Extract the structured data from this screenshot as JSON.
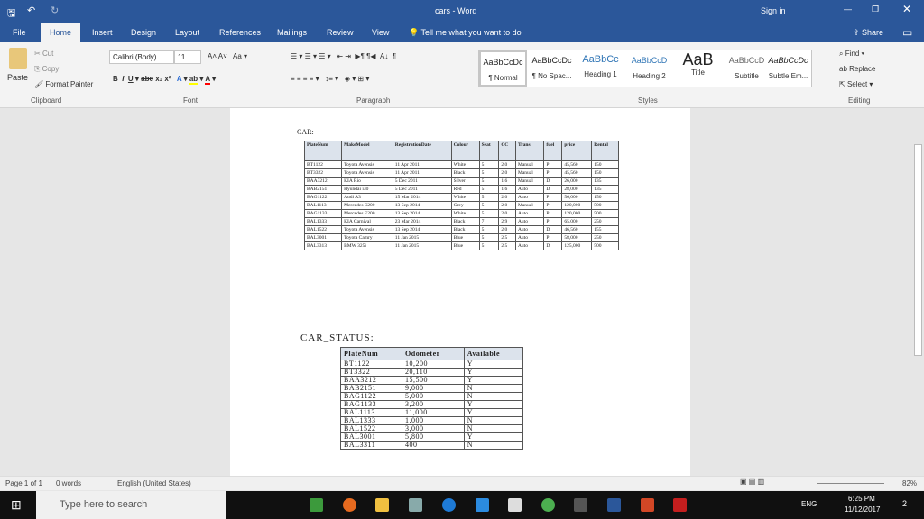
{
  "titlebar": {
    "title": "cars - Word",
    "sign_in": "Sign in"
  },
  "tabs": [
    "File",
    "Home",
    "Insert",
    "Design",
    "Layout",
    "References",
    "Mailings",
    "Review",
    "View"
  ],
  "tell_me": "Tell me what you want to do",
  "share": "Share",
  "clipboard": {
    "paste": "Paste",
    "cut": "Cut",
    "copy": "Copy",
    "format_painter": "Format Painter",
    "group": "Clipboard"
  },
  "font": {
    "name": "Calibri (Body)",
    "size": "11",
    "group": "Font"
  },
  "paragraph": {
    "group": "Paragraph"
  },
  "styles": {
    "group": "Styles",
    "items": [
      {
        "sample": "AaBbCcDc",
        "label": "¶ Normal"
      },
      {
        "sample": "AaBbCcDc",
        "label": "¶ No Spac..."
      },
      {
        "sample": "AaBbCc",
        "label": "Heading 1"
      },
      {
        "sample": "AaBbCcD",
        "label": "Heading 2"
      },
      {
        "sample": "AaB",
        "label": "Title"
      },
      {
        "sample": "AaBbCcD",
        "label": "Subtitle"
      },
      {
        "sample": "AaBbCcDc",
        "label": "Subtle Em..."
      }
    ]
  },
  "editing": {
    "find": "Find",
    "replace": "Replace",
    "select": "Select",
    "group": "Editing"
  },
  "document": {
    "car_heading": "CAR:",
    "car_headers": [
      "PlateNum",
      "MakeModel",
      "RegistrationDate",
      "Colour",
      "Seat",
      "CC",
      "Trans",
      "fuel",
      "price",
      "Rental"
    ],
    "car_rows": [
      [
        "BT1122",
        "Toyota Avensis",
        "11 Apr 2011",
        "White",
        "5",
        "2.0",
        "Manual",
        "P",
        "45,560",
        "150"
      ],
      [
        "BT3322",
        "Toyota Avensis",
        "11 Apr 2011",
        "Black",
        "5",
        "2.0",
        "Manual",
        "P",
        "45,560",
        "150"
      ],
      [
        "BAA3212",
        "KIA Rio",
        "5 Dec 2011",
        "Silver",
        "5",
        "1.6",
        "Manual",
        "D",
        "26,000",
        "135"
      ],
      [
        "BAB2151",
        "Hyundai i30",
        "5 Dec 2011",
        "Red",
        "5",
        "1.6",
        "Auto",
        "D",
        "28,000",
        "135"
      ],
      [
        "BAG1122",
        "Audi A3",
        "15 Mar 2014",
        "White",
        "5",
        "2.0",
        "Auto",
        "P",
        "56,000",
        "150"
      ],
      [
        "BAL1113",
        "Mercedes E200",
        "13 Sep 2014",
        "Grey",
        "5",
        "2.0",
        "Manual",
        "P",
        "120,000",
        "500"
      ],
      [
        "BAG1133",
        "Mercedes E200",
        "13 Sep 2014",
        "White",
        "5",
        "2.0",
        "Auto",
        "P",
        "120,000",
        "500"
      ],
      [
        "BAL1333",
        "KIA Carnival",
        "23 Mar 2014",
        "Black",
        "7",
        "2.9",
        "Auto",
        "P",
        "65,000",
        "250"
      ],
      [
        "BAL1522",
        "Toyota Avensis",
        "13 Sep 2014",
        "Black",
        "5",
        "2.0",
        "Auto",
        "D",
        "46,560",
        "155"
      ],
      [
        "BAL3001",
        "Toyota Camry",
        "11 Jan 2015",
        "Blue",
        "5",
        "2.5",
        "Auto",
        "P",
        "58,000",
        "250"
      ],
      [
        "BAL3313",
        "BMW 325i",
        "11 Jan 2015",
        "Blue",
        "5",
        "2.5",
        "Auto",
        "D",
        "125,000",
        "500"
      ]
    ],
    "status_heading": "CAR_STATUS:",
    "status_headers": [
      "PlateNum",
      "Odometer",
      "Available"
    ],
    "status_rows": [
      [
        "BT1122",
        "10,200",
        "Y"
      ],
      [
        "BT3322",
        "20,110",
        "Y"
      ],
      [
        "BAA3212",
        "15,500",
        "Y"
      ],
      [
        "BAB2151",
        "9,000",
        "N"
      ],
      [
        "BAG1122",
        "5,000",
        "N"
      ],
      [
        "BAG1133",
        "3,200",
        "Y"
      ],
      [
        "BAL1113",
        "11,000",
        "Y"
      ],
      [
        "BAL1333",
        "1,000",
        "N"
      ],
      [
        "BAL1522",
        "3,000",
        "N"
      ],
      [
        "BAL3001",
        "5,800",
        "Y"
      ],
      [
        "BAL3311",
        "400",
        "N"
      ]
    ]
  },
  "statusbar": {
    "page": "Page 1 of 1",
    "words": "0 words",
    "language": "English (United States)",
    "zoom": "82%"
  },
  "taskbar": {
    "search_placeholder": "Type here to search",
    "time": "6:25 PM",
    "date": "11/12/2017",
    "lang": "ENG",
    "notifications": "2"
  },
  "colors": {
    "accent": "#2b579a",
    "taskbar": "#101010"
  }
}
